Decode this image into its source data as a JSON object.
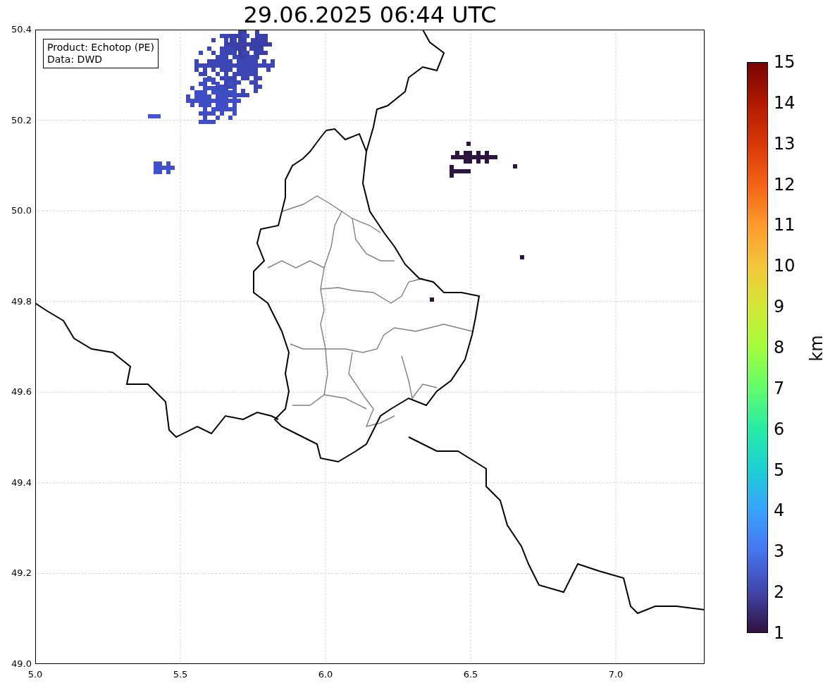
{
  "title": "29.06.2025 06:44 UTC",
  "info_box": [
    "Product: Echotop (PE)",
    "Data: DWD"
  ],
  "x_ticks": [
    "5.0",
    "5.5",
    "6.0",
    "6.5",
    "7.0"
  ],
  "y_ticks": [
    "50.4",
    "50.2",
    "50.0",
    "49.8",
    "49.6",
    "49.4",
    "49.2",
    "49.0"
  ],
  "colorbar": {
    "label": "km",
    "ticks": [
      "15",
      "14",
      "13",
      "12",
      "11",
      "10",
      "9",
      "8",
      "7",
      "6",
      "5",
      "4",
      "3",
      "2",
      "1"
    ]
  }
}
